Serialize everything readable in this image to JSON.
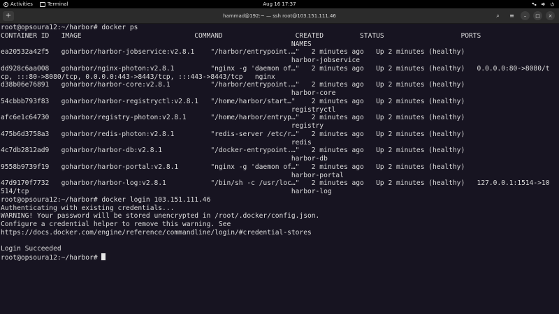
{
  "topbar": {
    "activities": "Activities",
    "app_name": "Terminal",
    "datetime": "Aug 16  17:37"
  },
  "window": {
    "title": "hammad@192:~ — ssh root@103.151.111.46",
    "new_tab": "+",
    "search": "⌕",
    "menu": "≡",
    "minimize": "–",
    "maximize": "□",
    "close": "×"
  },
  "terminal": {
    "lines": [
      "root@opsoura12:~/harbor# docker ps",
      "CONTAINER ID   IMAGE                            COMMAND                  CREATED         STATUS                   PORTS",
      "                                                                        NAMES",
      "ea20532a42f5   goharbor/harbor-jobservice:v2.8.1    \"/harbor/entrypoint.…\"   2 minutes ago   Up 2 minutes (healthy)",
      "                                                                        harbor-jobservice",
      "dd928c6aa008   goharbor/nginx-photon:v2.8.1         \"nginx -g 'daemon of…\"   2 minutes ago   Up 2 minutes (healthy)   0.0.0.0:80->8080/t",
      "cp, :::80->8080/tcp, 0.0.0.0:443->8443/tcp, :::443->8443/tcp   nginx",
      "d38b06e76891   goharbor/harbor-core:v2.8.1          \"/harbor/entrypoint.…\"   2 minutes ago   Up 2 minutes (healthy)",
      "                                                                        harbor-core",
      "54cbbb793f83   goharbor/harbor-registryctl:v2.8.1   \"/home/harbor/start…\"    2 minutes ago   Up 2 minutes (healthy)",
      "                                                                        registryctl",
      "afc6e1c64730   goharbor/registry-photon:v2.8.1      \"/home/harbor/entryp…\"   2 minutes ago   Up 2 minutes (healthy)",
      "                                                                        registry",
      "475b6d3758a3   goharbor/redis-photon:v2.8.1         \"redis-server /etc/r…\"   2 minutes ago   Up 2 minutes (healthy)",
      "                                                                        redis",
      "4c7db2812ad9   goharbor/harbor-db:v2.8.1            \"/docker-entrypoint.…\"   2 minutes ago   Up 2 minutes (healthy)",
      "                                                                        harbor-db",
      "9558b9739f19   goharbor/harbor-portal:v2.8.1        \"nginx -g 'daemon of…\"   2 minutes ago   Up 2 minutes (healthy)",
      "                                                                        harbor-portal",
      "47d9170f7732   goharbor/harbor-log:v2.8.1           \"/bin/sh -c /usr/loc…\"   2 minutes ago   Up 2 minutes (healthy)   127.0.0.1:1514->10",
      "514/tcp                                                                 harbor-log",
      "root@opsoura12:~/harbor# docker login 103.151.111.46",
      "Authenticating with existing credentials...",
      "WARNING! Your password will be stored unencrypted in /root/.docker/config.json.",
      "Configure a credential helper to remove this warning. See",
      "https://docs.docker.com/engine/reference/commandline/login/#credential-stores",
      "",
      "Login Succeeded"
    ],
    "prompt": "root@opsoura12:~/harbor# "
  }
}
